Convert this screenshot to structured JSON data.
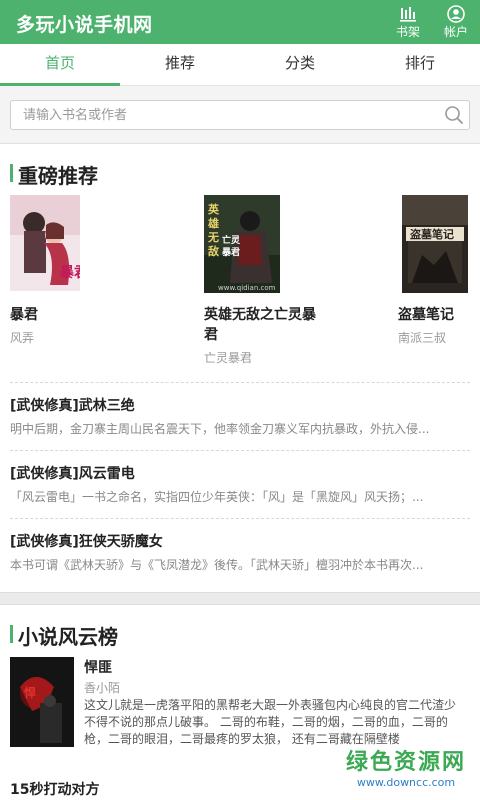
{
  "header": {
    "app_title": "多玩小说手机网",
    "shelf_label": "书架",
    "account_label": "帐户"
  },
  "tabs": [
    {
      "label": "首页",
      "active": true
    },
    {
      "label": "推荐",
      "active": false
    },
    {
      "label": "分类",
      "active": false
    },
    {
      "label": "排行",
      "active": false
    }
  ],
  "search": {
    "placeholder": "请输入书名或作者",
    "value": ""
  },
  "featured": {
    "section_title": "重磅推荐",
    "books": [
      {
        "title": "暴君",
        "author": "风弄",
        "cover_text": "暴君",
        "cover_icon": "romance-cover"
      },
      {
        "title": "英雄无敌之亡灵暴君",
        "author": "亡灵暴君",
        "cover_text": "英雄无敌之亡灵暴君",
        "cover_icon": "fantasy-warrior-cover",
        "cover_caption": "www.qidian.com"
      },
      {
        "title": "盗墓笔记",
        "author": "南派三叔",
        "cover_text": "盗墓笔记",
        "cover_icon": "tomb-cover"
      }
    ],
    "list": [
      {
        "title": "[武侠修真]武林三绝",
        "desc": "明中后期，金刀寨主周山民名震天下，他率领金刀寨义军内抗暴政，外抗入侵..."
      },
      {
        "title": "[武侠修真]风云雷电",
        "desc": "「风云雷电」一书之命名，实指四位少年英侠：「风」是「黑旋风」风天扬；..."
      },
      {
        "title": "[武侠修真]狂侠天骄魔女",
        "desc": "本书可谓《武林天骄》与《飞凤潜龙》後传。「武林天骄」檀羽冲於本书再次..."
      }
    ]
  },
  "ranking": {
    "section_title": "小说风云榜",
    "top_book": {
      "title": "悍匪",
      "author": "香小陌",
      "desc": "这文儿就是一虎落平阳的黑帮老大跟一外表骚包内心纯良的官二代渣少不得不说的那点儿破事。 二哥的布鞋，二哥的烟，二哥的血，二哥的枪，二哥的眼泪，二哥最疼的罗太狼， 还有二哥藏在隔壁楼"
    },
    "next_title": "15秒打动对方"
  },
  "watermark": {
    "main": "绿色资源网",
    "sub": "www.downcc.com"
  },
  "colors": {
    "brand_green": "#4cb26d",
    "section_gap": "#ebebeb"
  }
}
